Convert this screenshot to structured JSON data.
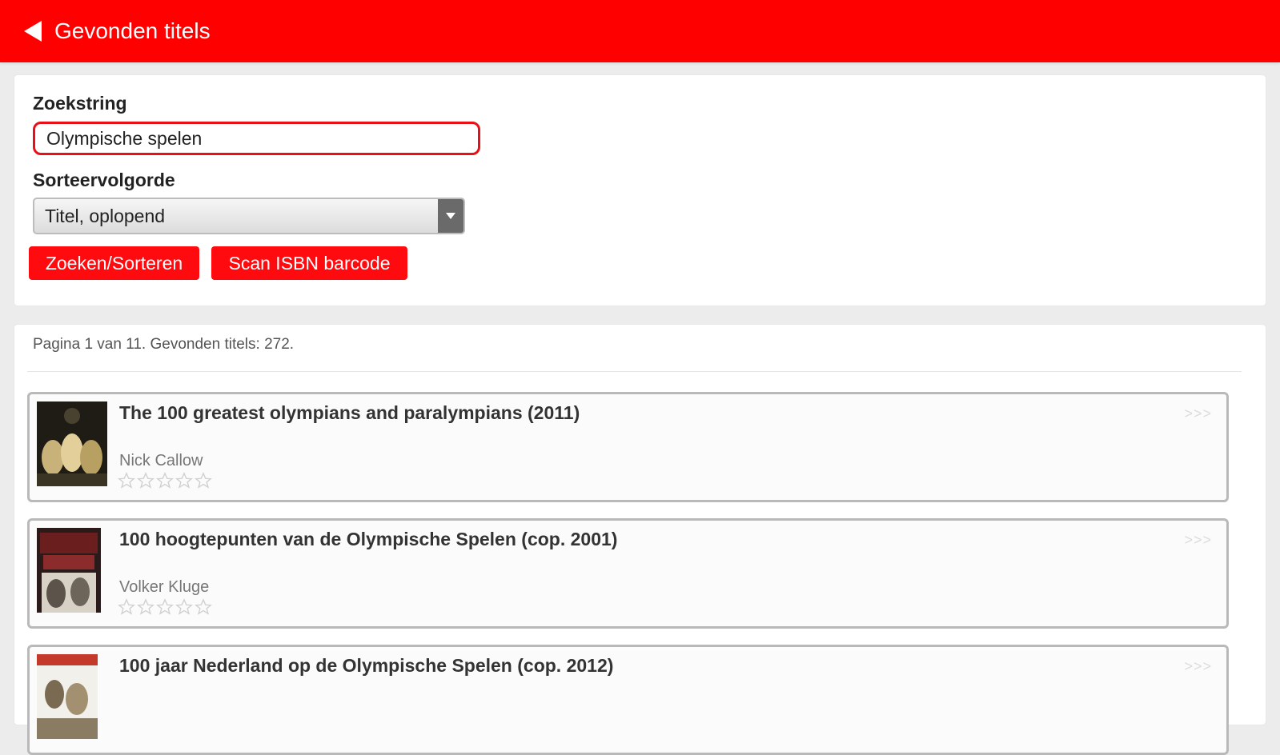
{
  "header": {
    "title": "Gevonden titels",
    "back_icon": "back-arrow-icon",
    "background": "#ff0000"
  },
  "search": {
    "query_label": "Zoekstring",
    "query_value": "Olympische spelen",
    "sort_label": "Sorteervolgorde",
    "sort_value": "Titel, oplopend",
    "search_button": "Zoeken/Sorteren",
    "scan_button": "Scan ISBN barcode",
    "accent": "#ff0a0f"
  },
  "results": {
    "summary": "Pagina 1 van 11. Gevonden titels: 272.",
    "items": [
      {
        "title": "The 100 greatest olympians and paralympians (2011)",
        "author": "Nick Callow",
        "rating": 0,
        "more": ">>>"
      },
      {
        "title": "100 hoogtepunten van de Olympische Spelen (cop. 2001)",
        "author": "Volker Kluge",
        "rating": 0,
        "more": ">>>"
      },
      {
        "title": "100 jaar Nederland op de Olympische Spelen (cop. 2012)",
        "author": "",
        "rating": 0,
        "more": ">>>"
      }
    ]
  }
}
